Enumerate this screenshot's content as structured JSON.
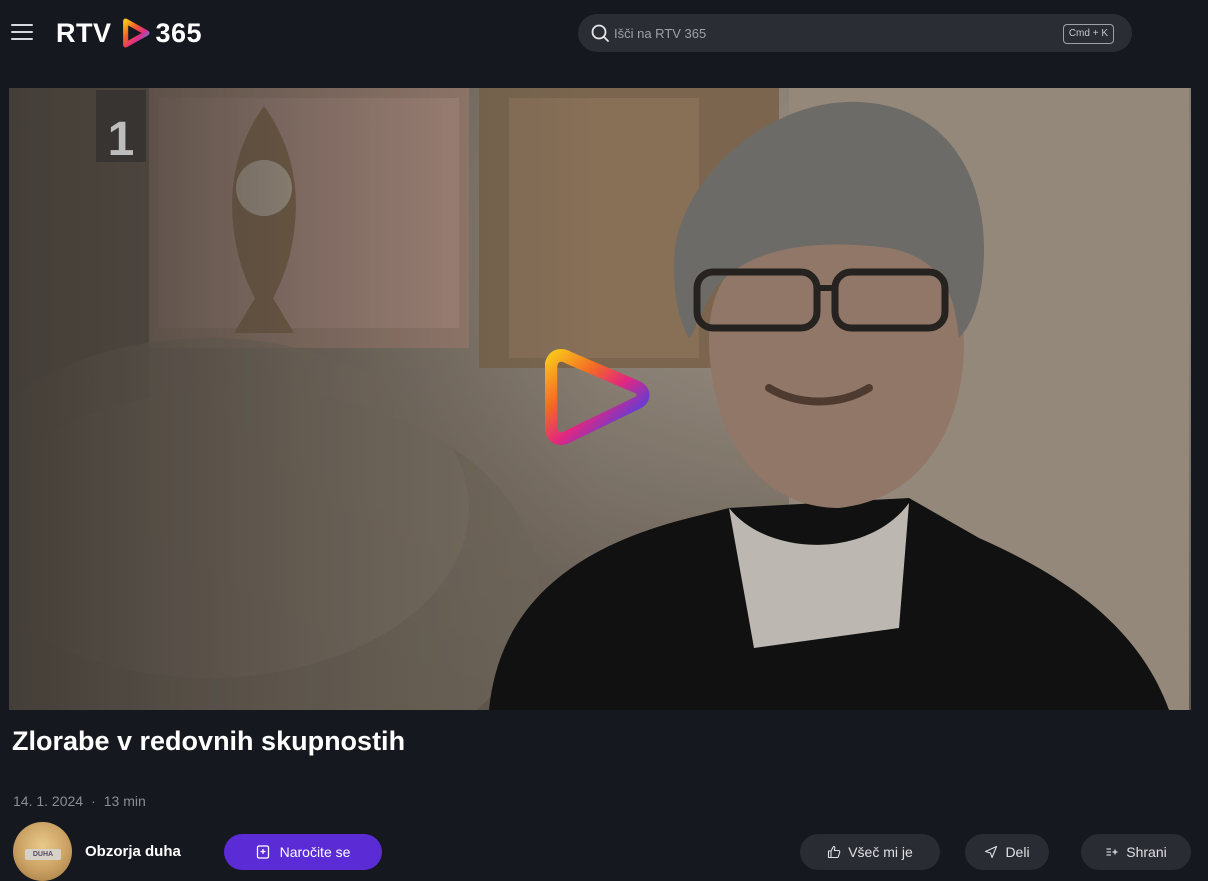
{
  "header": {
    "logo_left": "RTV",
    "logo_right": "365",
    "search_placeholder": "Išči na RTV 365",
    "search_shortcut": "Cmd + K"
  },
  "player": {
    "channel_badge": "1"
  },
  "video": {
    "title": "Zlorabe v redovnih skupnostih",
    "date": "14. 1. 2024",
    "separator": "·",
    "duration": "13 min"
  },
  "channel": {
    "name": "Obzorja duha",
    "avatar_text": "DUHA",
    "subscribe_label": "Naročite se"
  },
  "actions": {
    "like_label": "Všeč mi je",
    "share_label": "Deli",
    "save_label": "Shrani"
  },
  "colors": {
    "background": "#16181f",
    "subscribe_accent": "#5b2bd6",
    "pill_background": "#2a2c33"
  },
  "icons": [
    "menu-icon",
    "logo-play-icon",
    "search-icon",
    "play-icon",
    "bookmark-plus-icon",
    "thumbs-up-icon",
    "share-icon",
    "save-icon"
  ]
}
